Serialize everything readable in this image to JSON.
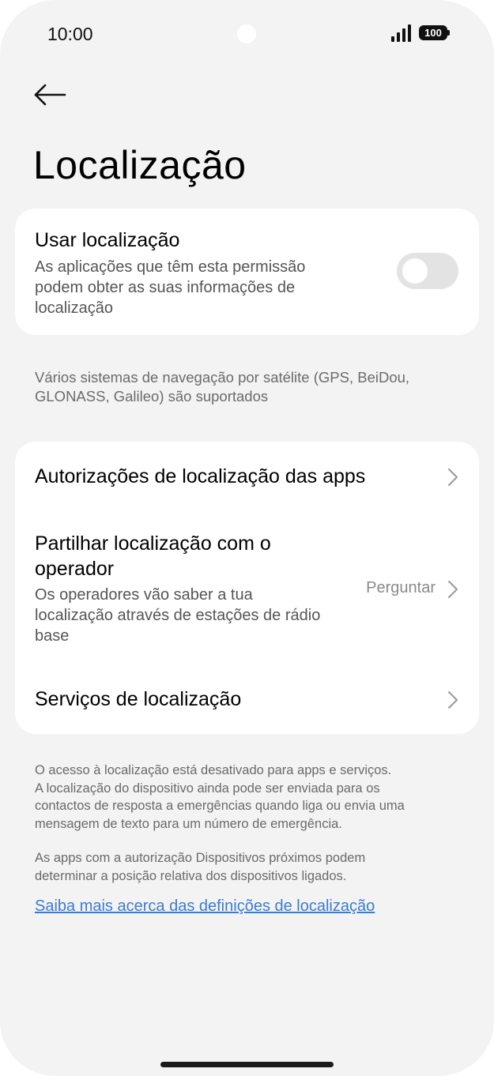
{
  "status_bar": {
    "time": "10:00",
    "battery": "100"
  },
  "header": {
    "title": "Localização"
  },
  "use_location": {
    "title": "Usar localização",
    "subtitle_lines": [
      "As aplicações que têm esta permissão",
      "podem obter as suas informações de",
      "localização"
    ],
    "toggle_on": false
  },
  "gnss_note": {
    "lines": [
      "Vários sistemas de navegação por satélite (GPS, BeiDou,",
      "GLONASS, Galileo) são suportados"
    ]
  },
  "settings_list": {
    "app_permissions": {
      "label": "Autorizações de localização das apps"
    },
    "share_with_carrier": {
      "title_lines": [
        "Partilhar localização com o",
        "operador"
      ],
      "subtitle_lines": [
        "Os operadores vão saber a tua",
        "localização através de estações de rádio",
        "base"
      ],
      "value": "Perguntar"
    },
    "location_services": {
      "label": "Serviços de localização"
    }
  },
  "info": {
    "paragraph1_lines": [
      "O acesso à localização está desativado para apps e serviços.",
      "A localização do dispositivo ainda pode ser enviada para os",
      "contactos de resposta a emergências quando liga ou envia uma",
      "mensagem de texto para um número de emergência."
    ],
    "paragraph2_lines": [
      "As apps com a autorização Dispositivos próximos podem",
      "determinar a posição relativa dos dispositivos ligados."
    ],
    "link": "Saiba mais acerca das definições de localização"
  },
  "colors": {
    "background": "#f3f3f3",
    "card": "#ffffff",
    "link": "#3a7bd5",
    "toggle_off": "#e3e3e3"
  }
}
